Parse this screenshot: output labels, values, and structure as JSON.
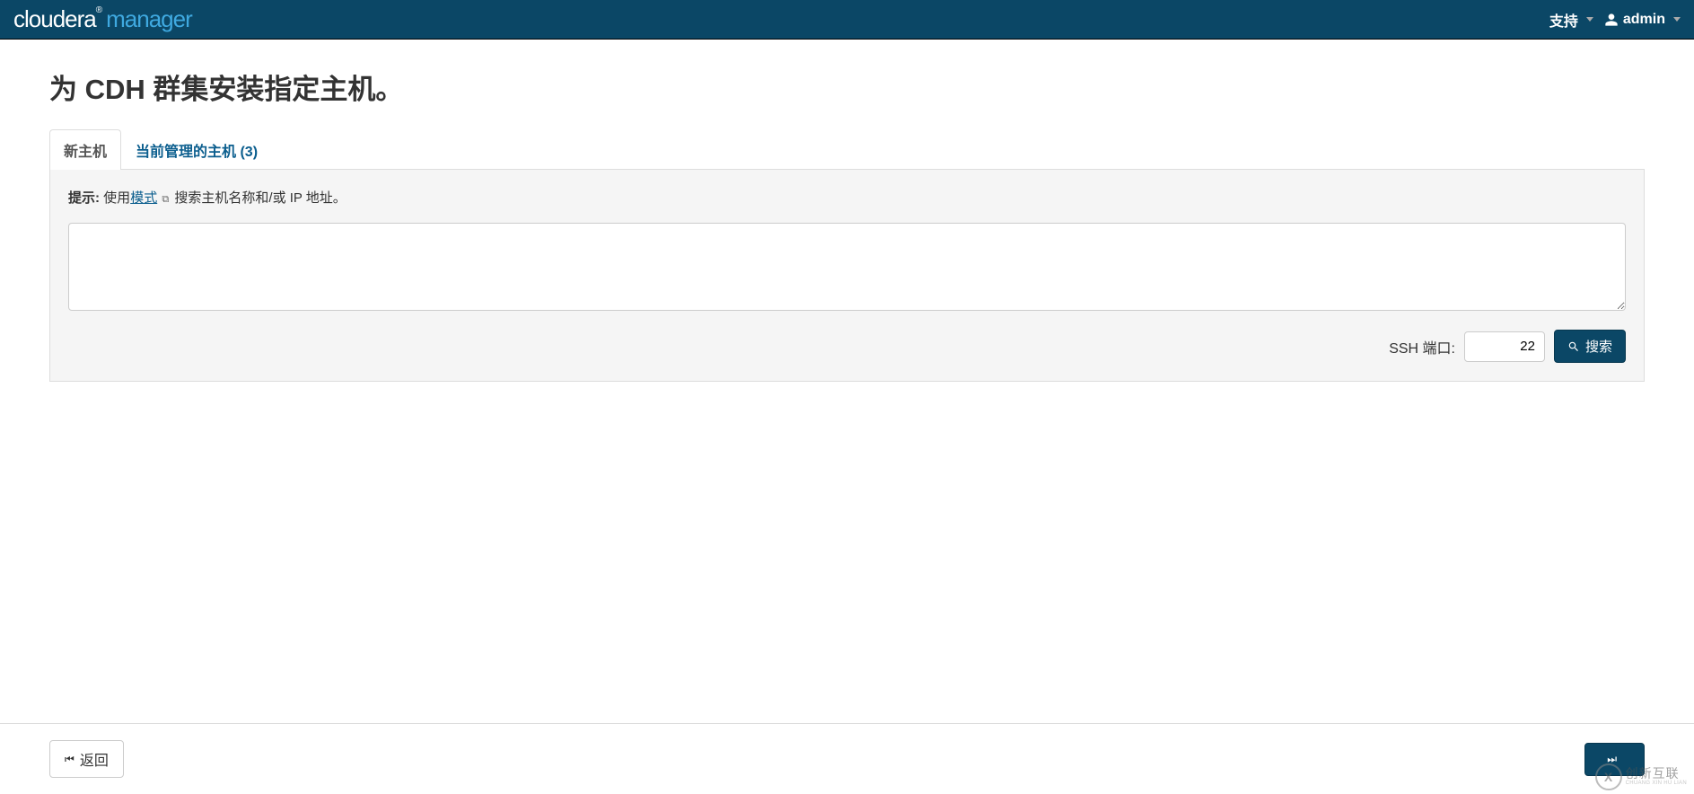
{
  "navbar": {
    "brand_part1": "cloudera",
    "brand_reg": "®",
    "brand_part2": "manager",
    "support_label": "支持",
    "user_label": "admin"
  },
  "page": {
    "title": "为 CDH 群集安装指定主机。"
  },
  "tabs": {
    "new_hosts": "新主机",
    "managed_hosts": "当前管理的主机 (3)"
  },
  "hint": {
    "label": "提示:",
    "use_text": "使用",
    "pattern_link": "模式",
    "tail_text": "搜索主机名称和/或 IP 地址。"
  },
  "hosts_textarea_value": "",
  "ssh": {
    "label": "SSH 端口:",
    "port": "22"
  },
  "buttons": {
    "search": "搜索",
    "back": "返回",
    "next": ""
  },
  "watermark": {
    "cn": "创新互联",
    "en": "CHUANG XIN HU LIAN"
  }
}
